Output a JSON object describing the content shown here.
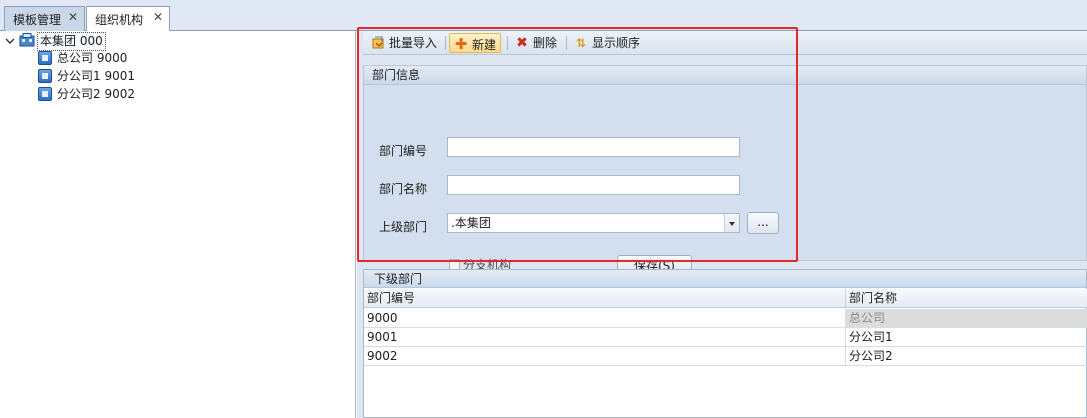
{
  "tabs": [
    {
      "label": "模板管理",
      "close": "✕"
    },
    {
      "label": "组织机构",
      "close": "✕"
    }
  ],
  "tree": {
    "root": {
      "label": "本集团   000"
    },
    "children": [
      {
        "label": "总公司   9000"
      },
      {
        "label": "分公司1   9001"
      },
      {
        "label": "分公司2   9002"
      }
    ]
  },
  "toolbar": {
    "import_label": "批量导入",
    "new_label": "新建",
    "delete_label": "删除",
    "order_label": "显示顺序"
  },
  "form": {
    "group_title": "部门信息",
    "code_label": "部门编号",
    "code_value": "",
    "name_label": "部门名称",
    "name_value": "",
    "parent_label": "上级部门",
    "parent_value": ".本集团",
    "ellipsis_label": "...",
    "branch_label": "分支机构",
    "save_label": "保存(S)"
  },
  "sub": {
    "title": "下级部门",
    "columns": [
      "部门编号",
      "部门名称"
    ],
    "rows": [
      [
        "9000",
        "总公司"
      ],
      [
        "9001",
        "分公司1"
      ],
      [
        "9002",
        "分公司2"
      ]
    ]
  },
  "colors": {
    "highlight": "#e5262a",
    "panel_bg": "#dde6f1",
    "hot_button": "#fdd98a"
  },
  "icons": {
    "import": "import-icon",
    "new": "plus-icon",
    "delete": "delete-x-icon",
    "order": "sort-order-icon",
    "tree_root": "building-icon",
    "tree_node": "department-node-icon"
  }
}
